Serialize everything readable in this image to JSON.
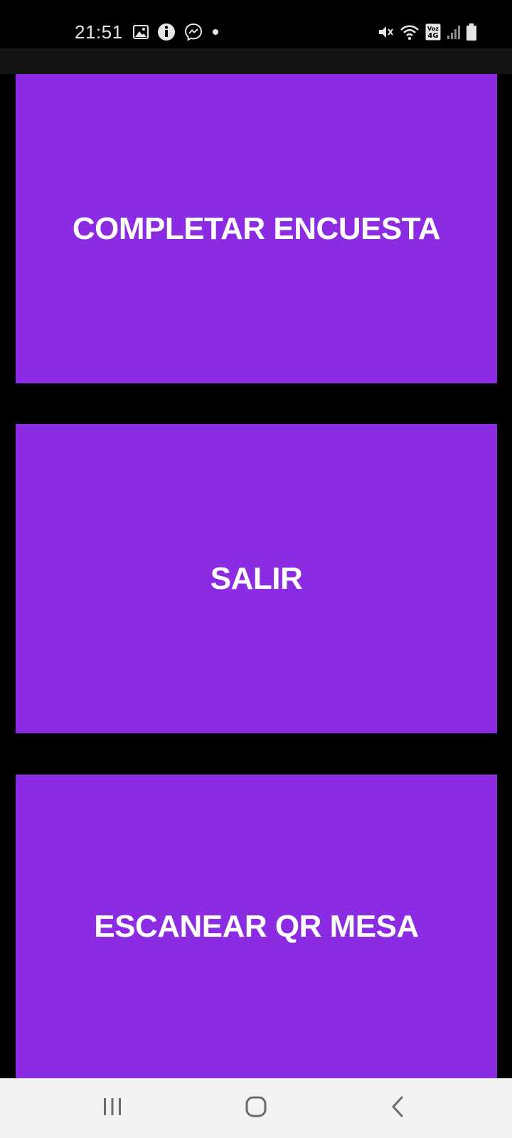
{
  "status_bar": {
    "time": "21:51",
    "left_icons": [
      "gallery-icon",
      "info-icon",
      "messenger-icon",
      "notification-dot-icon"
    ],
    "right_icons": [
      "mute-icon",
      "wifi-icon",
      "volte-4g-icon",
      "signal-icon",
      "battery-icon"
    ],
    "volte_label_top": "Voz",
    "volte_label_bottom": "4G"
  },
  "actions": [
    {
      "label": "COMPLETAR ENCUESTA"
    },
    {
      "label": "SALIR"
    },
    {
      "label": "ESCANEAR QR MESA"
    }
  ],
  "colors": {
    "tile_background": "#8b2be2",
    "tile_text": "#ffffff",
    "app_background": "#000000",
    "nav_background": "#f2f2f2"
  },
  "navigation_bar": {
    "buttons": [
      "recents-icon",
      "home-icon",
      "back-icon"
    ]
  }
}
